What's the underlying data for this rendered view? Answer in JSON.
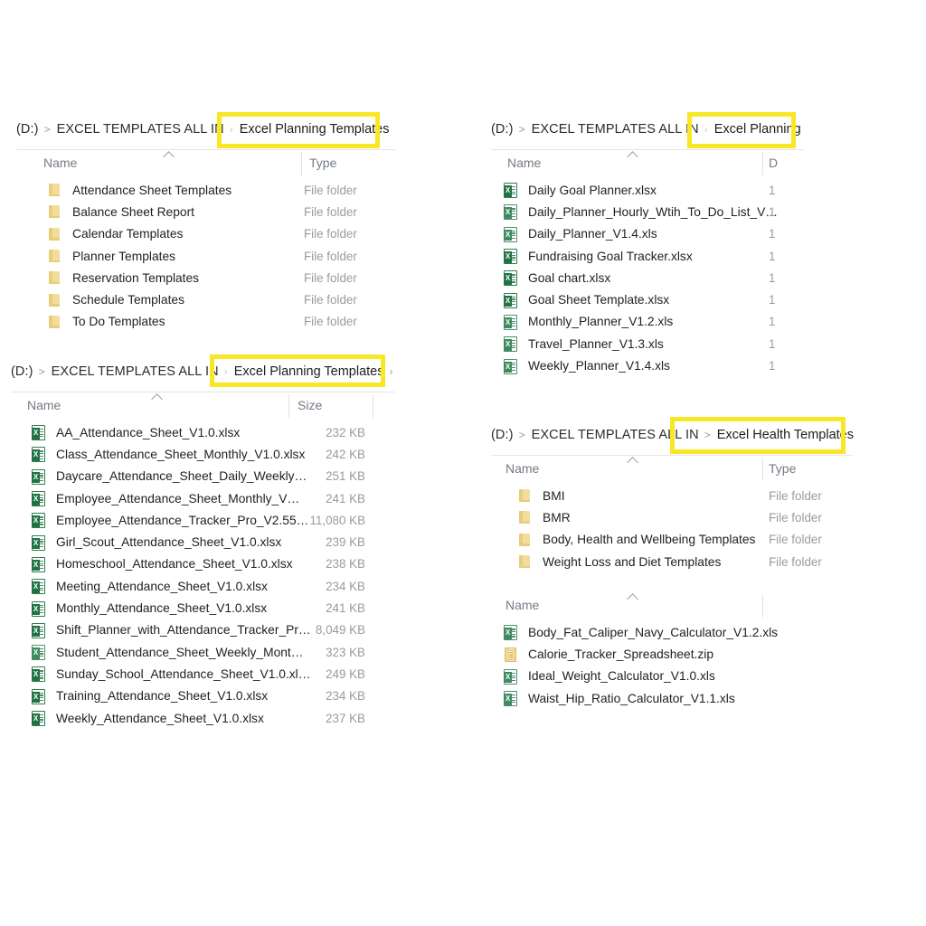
{
  "panels": [
    {
      "id": "planning-templates-folders",
      "breadcrumb": {
        "drive": "(D:)",
        "sep1": ">",
        "root": "EXCEL TEMPLATES ALL IN",
        "sep2": "›",
        "current": "Excel Planning Templates",
        "trailing": ""
      },
      "highlight_color": "#f7e725",
      "columns": {
        "name": "Name",
        "second": "Type"
      },
      "rows": [
        {
          "icon": "folder-icon",
          "name": "Attendance Sheet Templates",
          "meta": "File folder"
        },
        {
          "icon": "folder-icon",
          "name": "Balance Sheet Report",
          "meta": "File folder"
        },
        {
          "icon": "folder-icon",
          "name": "Calendar Templates",
          "meta": "File folder"
        },
        {
          "icon": "folder-icon",
          "name": "Planner Templates",
          "meta": "File folder"
        },
        {
          "icon": "folder-icon",
          "name": "Reservation Templates",
          "meta": "File folder"
        },
        {
          "icon": "folder-icon",
          "name": "Schedule Templates",
          "meta": "File folder"
        },
        {
          "icon": "folder-icon",
          "name": "To Do Templates",
          "meta": "File folder"
        }
      ]
    },
    {
      "id": "attendance-sheet-files",
      "breadcrumb": {
        "drive": "(D:)",
        "sep1": ">",
        "root": "EXCEL TEMPLATES ALL IN",
        "sep2": "›",
        "current": "Excel Planning Templates",
        "trailing": "›"
      },
      "highlight_color": "#f7e725",
      "columns": {
        "name": "Name",
        "second": "Size"
      },
      "rows": [
        {
          "icon": "excel-icon",
          "name": "AA_Attendance_Sheet_V1.0.xlsx",
          "meta": "232 KB"
        },
        {
          "icon": "excel-icon",
          "name": "Class_Attendance_Sheet_Monthly_V1.0.xlsx",
          "meta": "242 KB"
        },
        {
          "icon": "excel-icon",
          "name": "Daycare_Attendance_Sheet_Daily_Weekly…",
          "meta": "251 KB"
        },
        {
          "icon": "excel-icon",
          "name": "Employee_Attendance_Sheet_Monthly_V…",
          "meta": "241 KB"
        },
        {
          "icon": "excel-icon",
          "name": "Employee_Attendance_Tracker_Pro_V2.55…",
          "meta": "11,080 KB"
        },
        {
          "icon": "excel-icon",
          "name": "Girl_Scout_Attendance_Sheet_V1.0.xlsx",
          "meta": "239 KB"
        },
        {
          "icon": "excel-icon",
          "name": "Homeschool_Attendance_Sheet_V1.0.xlsx",
          "meta": "238 KB"
        },
        {
          "icon": "excel-icon",
          "name": "Meeting_Attendance_Sheet_V1.0.xlsx",
          "meta": "234 KB"
        },
        {
          "icon": "excel-icon",
          "name": "Monthly_Attendance_Sheet_V1.0.xlsx",
          "meta": "241 KB"
        },
        {
          "icon": "excel-icon",
          "name": "Shift_Planner_with_Attendance_Tracker_Pr…",
          "meta": "8,049 KB"
        },
        {
          "icon": "excel-icon-old",
          "name": "Student_Attendance_Sheet_Weekly_Mont…",
          "meta": "323 KB"
        },
        {
          "icon": "excel-icon",
          "name": "Sunday_School_Attendance_Sheet_V1.0.xl…",
          "meta": "249 KB"
        },
        {
          "icon": "excel-icon",
          "name": "Training_Attendance_Sheet_V1.0.xlsx",
          "meta": "234 KB"
        },
        {
          "icon": "excel-icon",
          "name": "Weekly_Attendance_Sheet_V1.0.xlsx",
          "meta": "237 KB"
        }
      ]
    },
    {
      "id": "excel-planning-files",
      "breadcrumb": {
        "drive": "(D:)",
        "sep1": ">",
        "root": "EXCEL TEMPLATES ALL IN",
        "sep2": "›",
        "current": "Excel Planning",
        "trailing": ""
      },
      "highlight_color": "#f7e725",
      "columns": {
        "name": "Name",
        "second": "D"
      },
      "rows": [
        {
          "icon": "excel-icon",
          "name": "Daily Goal Planner.xlsx",
          "meta": "1"
        },
        {
          "icon": "excel-icon-old",
          "name": "Daily_Planner_Hourly_Wtih_To_Do_List_V…",
          "meta": "1"
        },
        {
          "icon": "excel-icon-old",
          "name": "Daily_Planner_V1.4.xls",
          "meta": "1"
        },
        {
          "icon": "excel-icon",
          "name": "Fundraising Goal Tracker.xlsx",
          "meta": "1"
        },
        {
          "icon": "excel-icon",
          "name": "Goal chart.xlsx",
          "meta": "1"
        },
        {
          "icon": "excel-icon",
          "name": "Goal Sheet Template.xlsx",
          "meta": "1"
        },
        {
          "icon": "excel-icon-old",
          "name": "Monthly_Planner_V1.2.xls",
          "meta": "1"
        },
        {
          "icon": "excel-icon-old",
          "name": "Travel_Planner_V1.3.xls",
          "meta": "1"
        },
        {
          "icon": "excel-icon-old",
          "name": "Weekly_Planner_V1.4.xls",
          "meta": "1"
        }
      ]
    },
    {
      "id": "excel-health-templates",
      "breadcrumb": {
        "drive": "(D:)",
        "sep1": ">",
        "root": "EXCEL TEMPLATES ALL IN",
        "sep2": ">",
        "current": "Excel Health Templates",
        "trailing": ""
      },
      "highlight_color": "#f7e725",
      "columns": {
        "name": "Name",
        "second": "Type"
      },
      "rows": [
        {
          "icon": "folder-icon",
          "name": "BMI",
          "meta": "File folder"
        },
        {
          "icon": "folder-icon",
          "name": "BMR",
          "meta": "File folder"
        },
        {
          "icon": "folder-icon",
          "name": "Body, Health and Wellbeing Templates",
          "meta": "File folder"
        },
        {
          "icon": "folder-icon",
          "name": "Weight Loss and Diet Templates",
          "meta": "File folder"
        }
      ],
      "second_list": {
        "columns": {
          "name": "Name",
          "second": ""
        },
        "rows": [
          {
            "icon": "excel-icon-old",
            "name": "Body_Fat_Caliper_Navy_Calculator_V1.2.xls",
            "meta": ""
          },
          {
            "icon": "zip-icon",
            "name": "Calorie_Tracker_Spreadsheet.zip",
            "meta": ""
          },
          {
            "icon": "excel-icon-old",
            "name": "Ideal_Weight_Calculator_V1.0.xls",
            "meta": ""
          },
          {
            "icon": "excel-icon-old",
            "name": "Waist_Hip_Ratio_Calculator_V1.1.xls",
            "meta": ""
          }
        ]
      }
    }
  ]
}
